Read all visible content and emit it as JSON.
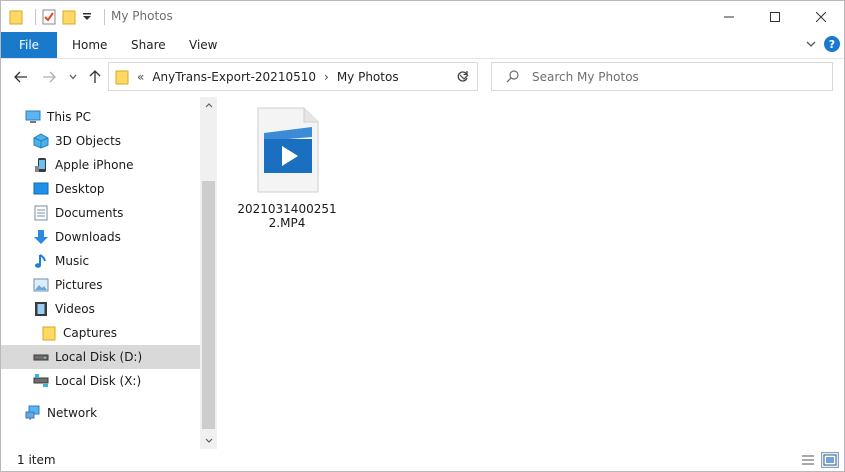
{
  "window": {
    "title": "My Photos"
  },
  "ribbon": {
    "tabs": [
      "File",
      "Home",
      "Share",
      "View"
    ]
  },
  "address": {
    "crumbs": [
      "AnyTrans-Export-20210510",
      "My Photos"
    ]
  },
  "search": {
    "placeholder": "Search My Photos"
  },
  "nav": {
    "items": [
      {
        "label": "This PC",
        "icon": "this-pc-icon"
      },
      {
        "label": "3D Objects",
        "icon": "3d-objects-icon"
      },
      {
        "label": "Apple iPhone",
        "icon": "iphone-icon"
      },
      {
        "label": "Desktop",
        "icon": "desktop-icon"
      },
      {
        "label": "Documents",
        "icon": "documents-icon"
      },
      {
        "label": "Downloads",
        "icon": "downloads-icon"
      },
      {
        "label": "Music",
        "icon": "music-icon"
      },
      {
        "label": "Pictures",
        "icon": "pictures-icon"
      },
      {
        "label": "Videos",
        "icon": "videos-icon"
      },
      {
        "label": "Captures",
        "icon": "folder-icon"
      },
      {
        "label": "Local Disk (D:)",
        "icon": "drive-icon",
        "selected": true
      },
      {
        "label": "Local Disk (X:)",
        "icon": "network-drive-icon"
      },
      {
        "label": "Network",
        "icon": "network-icon"
      }
    ]
  },
  "files": [
    {
      "name": "20210314002512.MP4",
      "icon": "video-file-icon"
    }
  ],
  "status": {
    "count": "1 item"
  },
  "colors": {
    "accent": "#1979ca",
    "selected": "#d9d9d9",
    "folder": "#ffd865"
  }
}
